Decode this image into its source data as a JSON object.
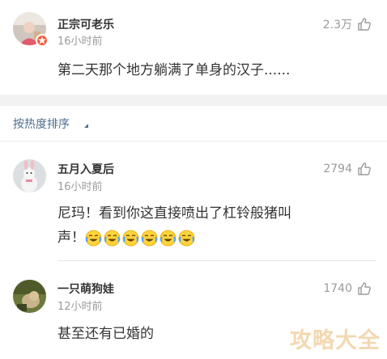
{
  "comments": [
    {
      "username": "正宗可老乐",
      "time": "16小时前",
      "likes": "2.3万",
      "text": "第二天那个地方躺满了单身的汉子......"
    },
    {
      "username": "五月入夏后",
      "time": "16小时前",
      "likes": "2794",
      "text_line1": "尼玛！看到你这直接喷出了杠铃般猪叫",
      "text_line2": "声！"
    },
    {
      "username": "一只萌狗娃",
      "time": "12小时前",
      "likes": "1740",
      "text": "甚至还有已婚的"
    }
  ],
  "sort": {
    "label": "按热度排序"
  },
  "watermark": "攻略大全",
  "icons": {
    "like": "thumbs-up-icon",
    "emoji": "laughing-crying-emoji-icon",
    "sort": "triangle-icon"
  },
  "colors": {
    "link": "#4e6e8e",
    "muted": "#9b9b9b",
    "text": "#333333"
  }
}
